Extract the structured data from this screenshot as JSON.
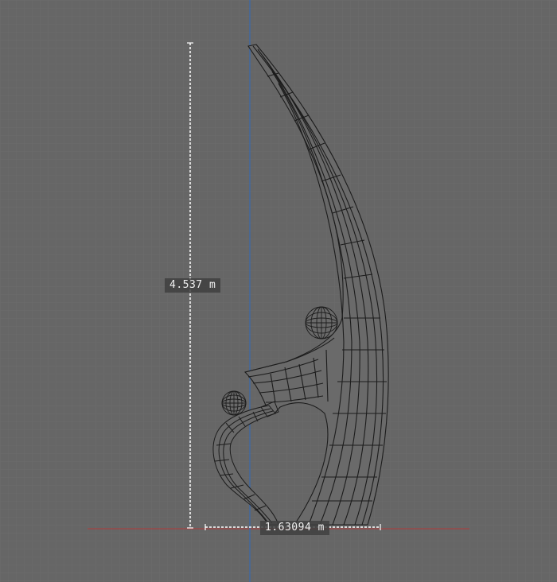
{
  "viewport": {
    "background_color": "#666666",
    "grid_color": "#6d6d6d",
    "x_axis_color": "#b23a3a",
    "z_axis_color": "#3d6aa8",
    "wire_color": "#1c1c1c",
    "measure_color": "#ffffff"
  },
  "measurements": {
    "height_label": "4.537 m",
    "width_label": "1.63094 m"
  }
}
